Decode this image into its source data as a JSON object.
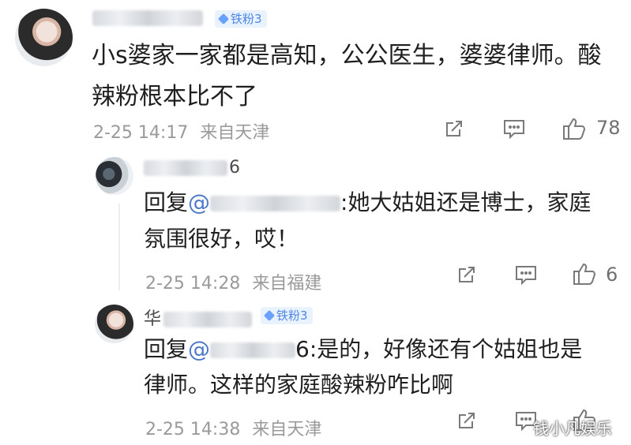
{
  "comment": {
    "badge": "铁粉3",
    "text_line1": "小s婆家一家都是高知，公公医生，婆婆律师。酸",
    "text_line2": "辣粉根本比不了",
    "time": "2-25 14:17",
    "location": "来自天津",
    "likes": "78"
  },
  "reply1": {
    "name_suffix": "6",
    "prefix": "回复",
    "mention": "@",
    "mention_tail": ":她大姑姐还是博士，家庭",
    "text_line2": "氛围很好，哎！",
    "time": "2-25 14:28",
    "location": "来自福建",
    "likes": "6"
  },
  "reply2": {
    "name_prefix": "华",
    "badge": "铁粉3",
    "prefix": "回复",
    "mention": "@",
    "mention_tail": "6:是的，好像还有个姑姐也是",
    "text_line2": "律师。这样的家庭酸辣粉咋比啊",
    "time": "2-25 14:38",
    "location": "来自天津"
  },
  "watermark": "钱小凡娱乐",
  "icons": {
    "share": "share-icon",
    "comment": "comment-icon",
    "like": "thumbs-up-icon",
    "badge": "diamond-icon"
  }
}
